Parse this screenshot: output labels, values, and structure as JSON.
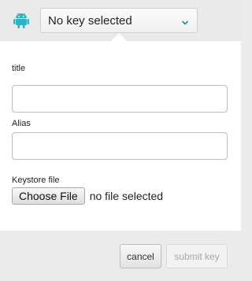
{
  "colors": {
    "android_green": "#2bb3c6",
    "chevron": "#1d8ea8"
  },
  "header": {
    "platform_icon": "android-icon",
    "key_select_value": "No key selected",
    "chevron_icon": "chevron-down-icon"
  },
  "form": {
    "title_label": "title",
    "title_value": "",
    "alias_label": "Alias",
    "alias_value": "",
    "keystore_label": "Keystore file",
    "choose_file_label": "Choose File",
    "file_status": "no file selected"
  },
  "footer": {
    "cancel_label": "cancel",
    "submit_label": "submit key"
  }
}
